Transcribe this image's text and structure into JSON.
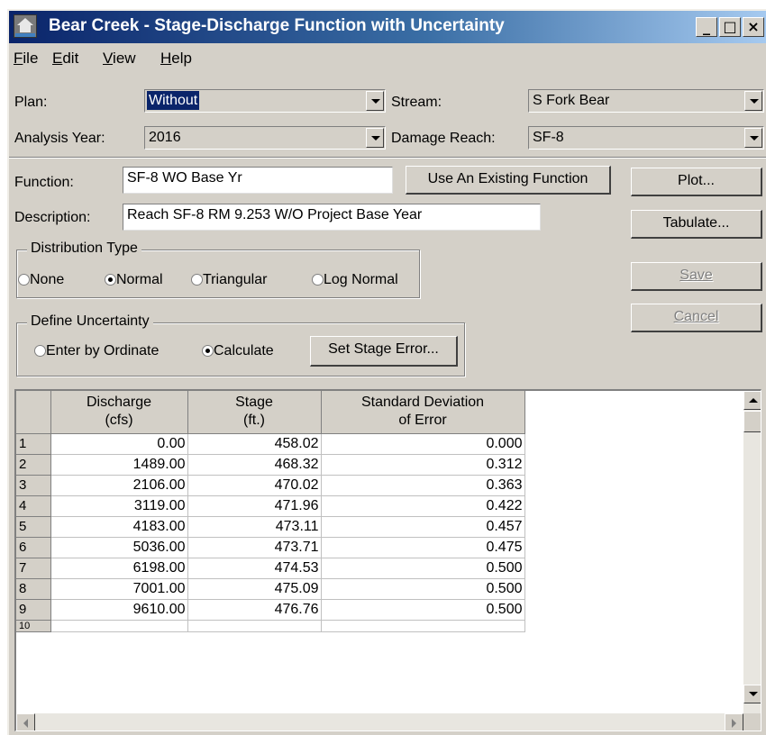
{
  "window": {
    "title": "Bear Creek - Stage-Discharge Function with Uncertainty",
    "controls": {
      "minimize": "_",
      "maximize": "□",
      "close": "×"
    }
  },
  "menu": [
    {
      "label": "File",
      "mnemonic": "F",
      "rest": "ile"
    },
    {
      "label": "Edit",
      "mnemonic": "E",
      "rest": "dit"
    },
    {
      "label": "View",
      "mnemonic": "V",
      "rest": "iew"
    },
    {
      "label": "Help",
      "mnemonic": "H",
      "rest": "elp"
    }
  ],
  "selectors": {
    "plan_label": "Plan:",
    "plan_value": "Without",
    "stream_label": "Stream:",
    "stream_value": "S Fork Bear",
    "year_label": "Analysis Year:",
    "year_value": "2016",
    "reach_label": "Damage Reach:",
    "reach_value": "SF-8"
  },
  "function": {
    "label": "Function:",
    "value": "SF-8 WO Base Yr",
    "use_existing": "Use An Existing Function",
    "description_label": "Description:",
    "description_value": "Reach SF-8 RM 9.253 W/O Project Base Year"
  },
  "side_buttons": {
    "plot": "Plot...",
    "tabulate": "Tabulate...",
    "save": "Save",
    "cancel": "Cancel"
  },
  "distribution": {
    "title": "Distribution Type",
    "options": [
      "None",
      "Normal",
      "Triangular",
      "Log Normal"
    ],
    "selected": "Normal"
  },
  "uncertainty": {
    "title": "Define Uncertainty",
    "options": [
      "Enter by Ordinate",
      "Calculate"
    ],
    "selected": "Calculate",
    "set_stage_error": "Set Stage Error..."
  },
  "table": {
    "headers": [
      {
        "line1": "Discharge",
        "line2": "(cfs)"
      },
      {
        "line1": "Stage",
        "line2": "(ft.)"
      },
      {
        "line1": "Standard Deviation",
        "line2": "of Error"
      }
    ],
    "rows": [
      {
        "n": "1",
        "discharge": "0.00",
        "stage": "458.02",
        "sd": "0.000"
      },
      {
        "n": "2",
        "discharge": "1489.00",
        "stage": "468.32",
        "sd": "0.312"
      },
      {
        "n": "3",
        "discharge": "2106.00",
        "stage": "470.02",
        "sd": "0.363"
      },
      {
        "n": "4",
        "discharge": "3119.00",
        "stage": "471.96",
        "sd": "0.422"
      },
      {
        "n": "5",
        "discharge": "4183.00",
        "stage": "473.11",
        "sd": "0.457"
      },
      {
        "n": "6",
        "discharge": "5036.00",
        "stage": "473.71",
        "sd": "0.475"
      },
      {
        "n": "7",
        "discharge": "6198.00",
        "stage": "474.53",
        "sd": "0.500"
      },
      {
        "n": "8",
        "discharge": "7001.00",
        "stage": "475.09",
        "sd": "0.500"
      },
      {
        "n": "9",
        "discharge": "9610.00",
        "stage": "476.76",
        "sd": "0.500"
      }
    ],
    "partial_row": "10"
  }
}
